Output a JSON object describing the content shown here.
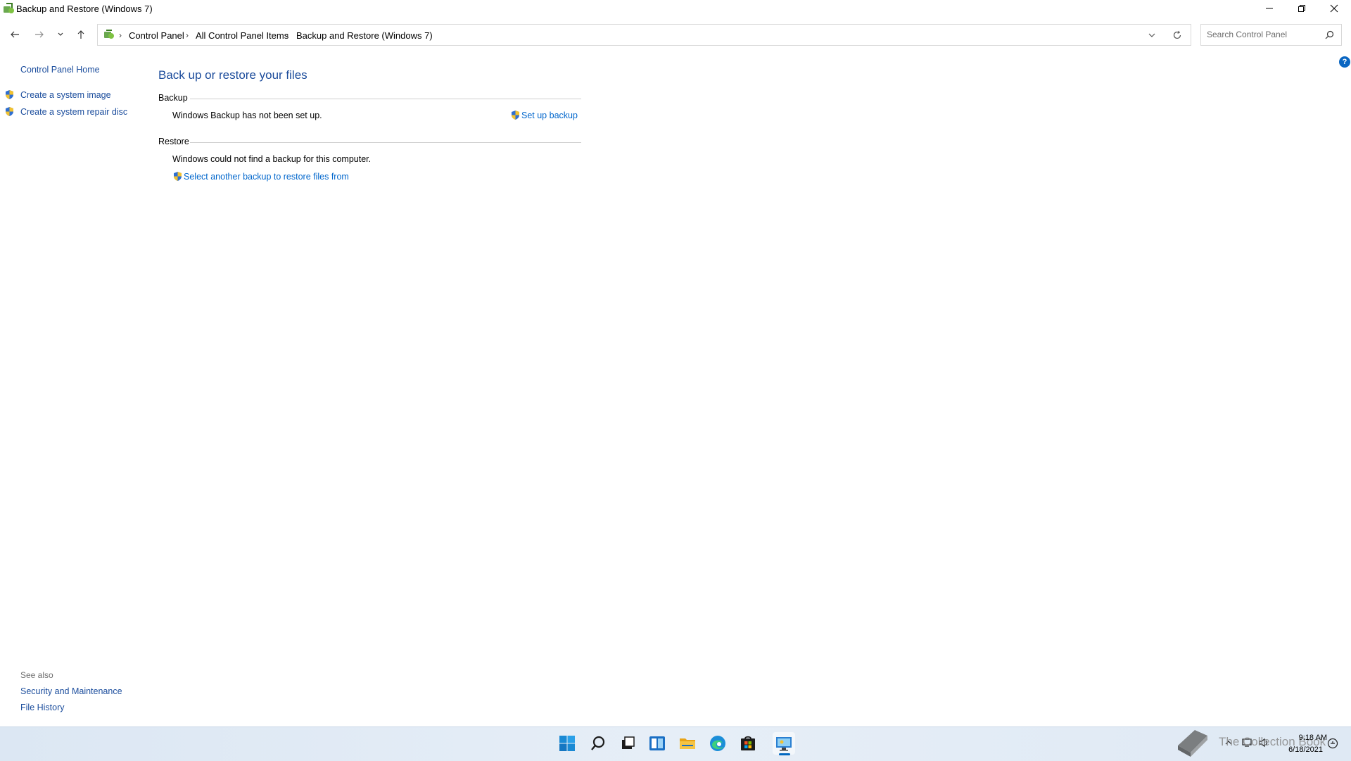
{
  "window": {
    "title": "Backup and Restore (Windows 7)"
  },
  "address": {
    "crumbs": [
      "Control Panel",
      "All Control Panel Items",
      "Backup and Restore (Windows 7)"
    ],
    "search_placeholder": "Search Control Panel"
  },
  "left_pane": {
    "home": "Control Panel Home",
    "tasks": [
      "Create a system image",
      "Create a system repair disc"
    ],
    "see_also_label": "See also",
    "see_also": [
      "Security and Maintenance",
      "File History"
    ]
  },
  "main": {
    "title": "Back up or restore your files",
    "backup": {
      "heading": "Backup",
      "status": "Windows Backup has not been set up.",
      "action": "Set up backup"
    },
    "restore": {
      "heading": "Restore",
      "status": "Windows could not find a backup for this computer.",
      "action": "Select another backup to restore files from"
    }
  },
  "help": "?",
  "taskbar": {
    "icons": [
      "windows-start-icon",
      "search-icon",
      "task-view-icon",
      "widgets-icon",
      "file-explorer-icon",
      "edge-icon",
      "store-icon",
      "control-panel-icon"
    ],
    "time": "9:18 AM",
    "date": "6/18/2021",
    "watermark": "The Collection Book"
  },
  "colors": {
    "link": "#0066cc",
    "title": "#1b4b9b",
    "accent": "#0067c0"
  }
}
